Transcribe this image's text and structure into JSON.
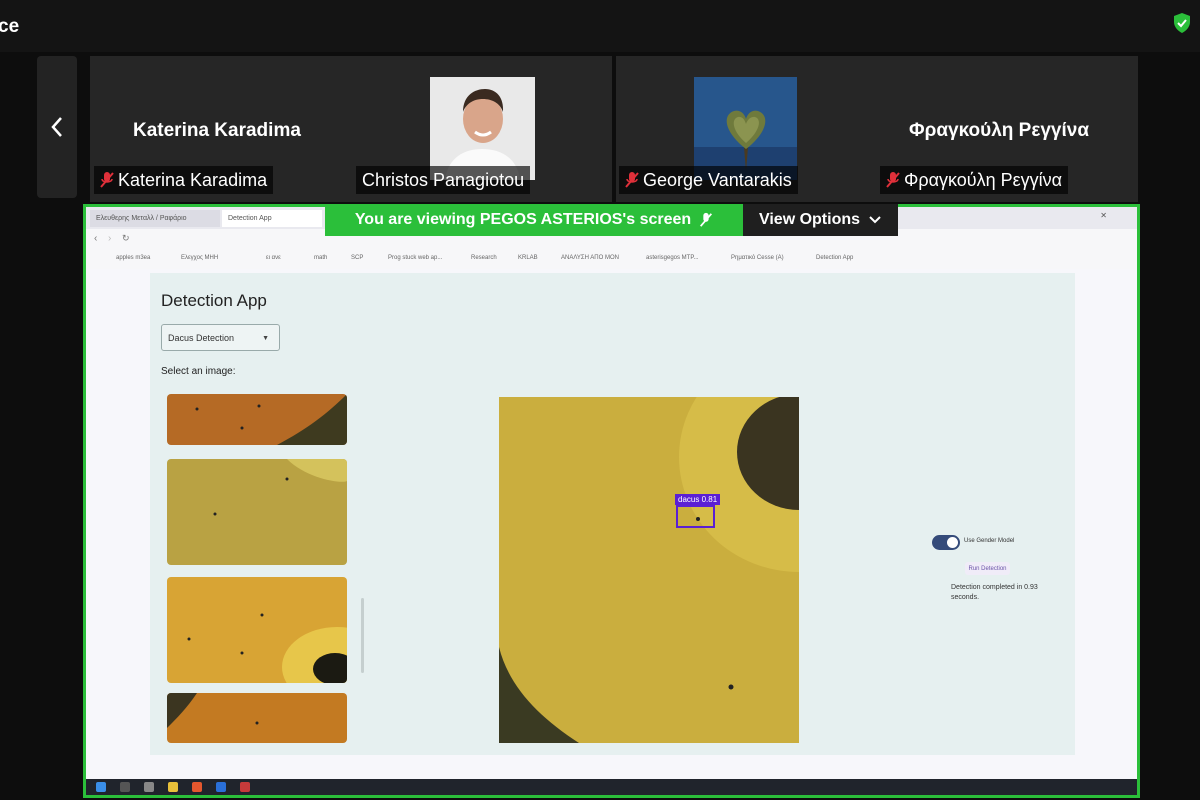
{
  "app": {
    "title": "ce"
  },
  "participants": [
    {
      "name_large": "Katerina Karadima",
      "name_tag": "Katerina Karadima",
      "muted": true,
      "has_photo": false
    },
    {
      "name_large": "",
      "name_tag": "Christos Panagiotou",
      "muted": false,
      "has_photo": true
    },
    {
      "name_large": "",
      "name_tag": "George Vantarakis",
      "muted": true,
      "has_photo": true
    },
    {
      "name_large": "Φραγκούλη Ρεγγίνα",
      "name_tag": "Φραγκούλη Ρεγγίνα",
      "muted": true,
      "has_photo": false
    }
  ],
  "share": {
    "banner": "You are viewing  PEGOS ASTERIOS's screen",
    "view_options": "View Options",
    "accent": "#2bbf3a"
  },
  "browser": {
    "tabs": [
      "Ελευθερης Μεταλλ / Ραφάριο",
      "Detection App"
    ],
    "bookmarks": [
      "apples m3ea",
      "Ελεγχος ΜΗΗ",
      "ει ανε",
      "math",
      "SCP",
      "Prog stuck web ap...",
      "Research",
      "KRLAB",
      "ΑΝΑΛΥΣΗ ΑΠΟ ΜΟΝ",
      "asterisgegos MTP...",
      "Ρηματικό Cesse (A)",
      "Detection App"
    ]
  },
  "detection_app": {
    "title": "Detection App",
    "model_select": "Dacus Detection",
    "select_label": "Select an image:",
    "detection": {
      "label": "dacus",
      "confidence": "0.81"
    },
    "toggle_label": "Use Gender Model",
    "toggle_on": true,
    "run_button": "Run Detection",
    "status": "Detection completed in 0.93 seconds."
  }
}
